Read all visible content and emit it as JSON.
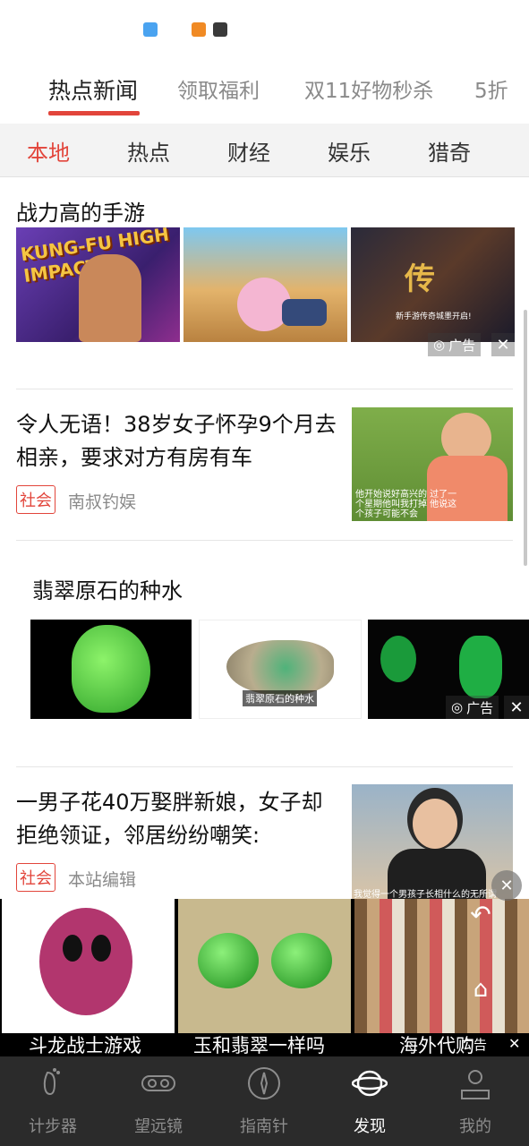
{
  "top_tabs": [
    {
      "label": "热点新闻",
      "active": true
    },
    {
      "label": "领取福利",
      "active": false
    },
    {
      "label": "双11好物秒杀",
      "active": false
    },
    {
      "label": "5折",
      "active": false
    }
  ],
  "categories": [
    {
      "label": "本地",
      "active": true
    },
    {
      "label": "热点",
      "active": false
    },
    {
      "label": "财经",
      "active": false
    },
    {
      "label": "娱乐",
      "active": false
    },
    {
      "label": "猎奇",
      "active": false
    }
  ],
  "ad1": {
    "title": "战力高的手游",
    "badge": "广告",
    "images": [
      {
        "caption": "KUNG-FU HIGH IMPACT"
      },
      {
        "caption": ""
      },
      {
        "caption": "新手游传奇城墨开启!"
      }
    ]
  },
  "news1": {
    "title": "令人无语！38岁女子怀孕9个月去相亲，要求对方有房有车",
    "tag": "社会",
    "source": "南叔钓娱",
    "subtitle": "他开始说好高兴的 过了一个星期他叫我打掉 他说这个孩子可能不会"
  },
  "ad2": {
    "title": "翡翠原石的种水",
    "badge": "广告",
    "image_caption": "翡翠原石的种水"
  },
  "news2": {
    "title": "一男子花40万娶胖新娘，女子却拒绝领证，邻居纷纷嘲笑:",
    "tag": "社会",
    "source": "本站编辑",
    "subtitle": "我觉得一个男孩子长相什么的无所谓"
  },
  "bottom_ad": {
    "items": [
      {
        "label": "斗龙战士游戏"
      },
      {
        "label": "玉和翡翠一样吗"
      },
      {
        "label": "海外代购"
      }
    ],
    "badge": "广告"
  },
  "nav": [
    {
      "label": "计步器",
      "icon": "footprint-icon",
      "active": false
    },
    {
      "label": "望远镜",
      "icon": "binoculars-icon",
      "active": false
    },
    {
      "label": "指南针",
      "icon": "compass-icon",
      "active": false
    },
    {
      "label": "发现",
      "icon": "planet-icon",
      "active": true
    },
    {
      "label": "我的",
      "icon": "profile-icon",
      "active": false
    }
  ],
  "colors": {
    "accent": "#e2453b",
    "nav_bg": "#2b2b2b"
  }
}
